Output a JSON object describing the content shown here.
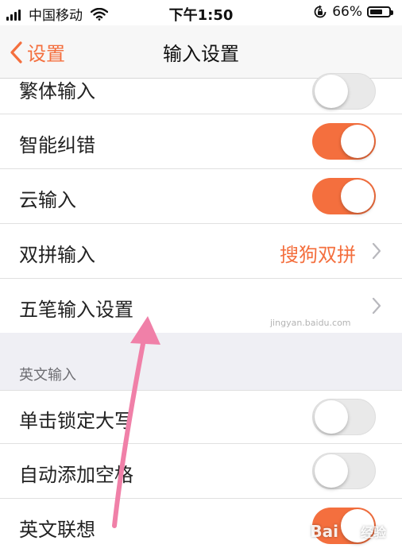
{
  "status_bar": {
    "carrier": "中国移动",
    "time": "下午1:50",
    "battery_percent": "66%",
    "battery_level": 0.66,
    "icons": [
      "signal-icon",
      "wifi-icon",
      "orientation-lock-icon",
      "battery-icon"
    ]
  },
  "nav": {
    "back_label": "设置",
    "title": "输入设置"
  },
  "rows": {
    "traditional": {
      "label": "繁体输入",
      "toggle": "off"
    },
    "smart_correct": {
      "label": "智能纠错",
      "toggle": "on"
    },
    "cloud_input": {
      "label": "云输入",
      "toggle": "on"
    },
    "double_pinyin": {
      "label": "双拼输入",
      "value": "搜狗双拼"
    },
    "wubi": {
      "label": "五笔输入设置"
    }
  },
  "english_section": {
    "header": "英文输入",
    "rows": {
      "caps_lock": {
        "label": "单击锁定大写",
        "toggle": "off"
      },
      "auto_space": {
        "label": "自动添加空格",
        "toggle": "off"
      },
      "english_assoc": {
        "label": "英文联想",
        "toggle": "on"
      }
    }
  },
  "watermark": {
    "url": "jingyan.baidu.com",
    "logo_text": "Bai",
    "logo_suffix": "经验"
  },
  "colors": {
    "accent": "#f46f3e",
    "toggle_off": "#e9e9e9",
    "section_bg": "#efeff4",
    "arrow": "#f080a8"
  }
}
